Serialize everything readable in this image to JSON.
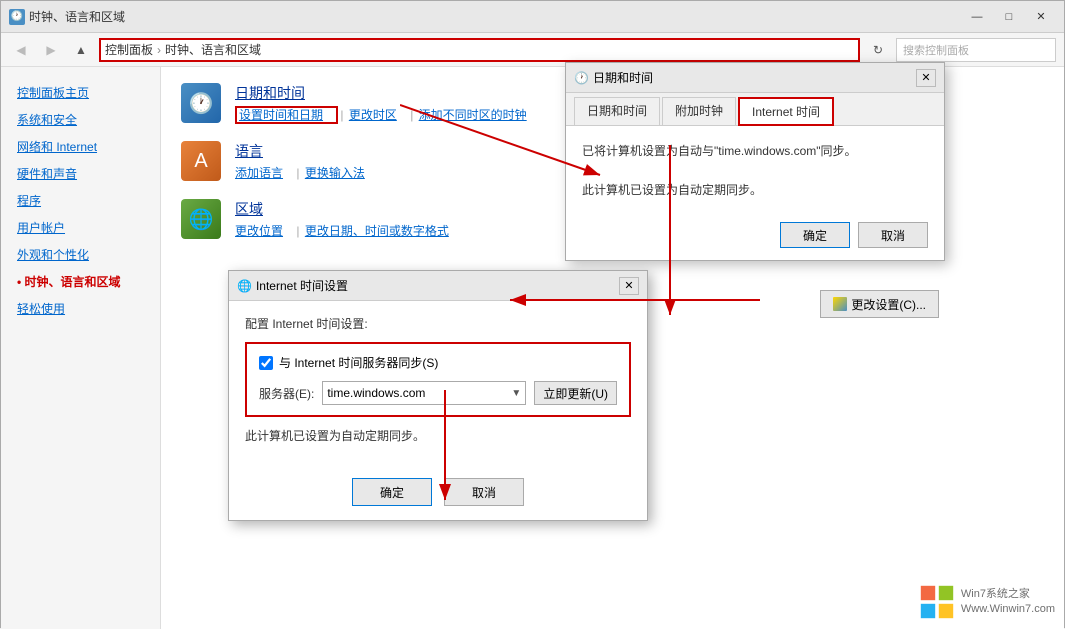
{
  "window": {
    "title": "时钟、语言和区域",
    "controls": [
      "—",
      "□",
      "✕"
    ]
  },
  "addressBar": {
    "breadcrumb": [
      "控制面板",
      "时钟、语言和区域"
    ],
    "breadcrumbSep": "›",
    "searchPlaceholder": "搜索控制面板"
  },
  "sidebar": {
    "items": [
      {
        "label": "控制面板主页",
        "active": false
      },
      {
        "label": "系统和安全",
        "active": false
      },
      {
        "label": "网络和 Internet",
        "active": false
      },
      {
        "label": "硬件和声音",
        "active": false
      },
      {
        "label": "程序",
        "active": false
      },
      {
        "label": "用户帐户",
        "active": false
      },
      {
        "label": "外观和个性化",
        "active": false
      },
      {
        "label": "时钟、语言和区域",
        "active": true
      },
      {
        "label": "轻松使用",
        "active": false
      }
    ]
  },
  "categories": [
    {
      "id": "clock",
      "title": "日期和时间",
      "links": [
        {
          "label": "设置时间和日期",
          "highlighted": true
        },
        {
          "label": "更改时区"
        },
        {
          "label": "添加不同时区的时钟"
        }
      ]
    },
    {
      "id": "language",
      "title": "语言",
      "links": [
        {
          "label": "添加语言"
        },
        {
          "label": "更换输入法"
        }
      ]
    },
    {
      "id": "region",
      "title": "区域",
      "links": [
        {
          "label": "更改位置"
        },
        {
          "label": "更改日期、时间或数字格式"
        }
      ]
    }
  ],
  "datetimeDialog": {
    "title": "日期和时间",
    "tabs": [
      {
        "label": "日期和时间"
      },
      {
        "label": "附加时钟"
      },
      {
        "label": "Internet 时间",
        "highlighted": true
      }
    ],
    "content": {
      "line1": "已将计算机设置为自动与\"time.windows.com\"同步。",
      "line2": "此计算机已设置为自动定期同步。"
    },
    "changeSettingsBtn": "更改设置(C)...",
    "buttons": [
      "确定",
      "取消"
    ]
  },
  "internetSettingsDialog": {
    "title": "Internet 时间设置",
    "sectionLabel": "配置 Internet 时间设置:",
    "syncCheckbox": "与 Internet 时间服务器同步(S)",
    "serverLabel": "服务器(E):",
    "serverValue": "time.windows.com",
    "updateBtn": "立即更新(U)",
    "statusText": "此计算机已设置为自动定期同步。",
    "buttons": [
      "确定",
      "取消"
    ]
  },
  "watermark": {
    "line1": "Win7系统之家",
    "line2": "Www.Winwin7.com"
  }
}
